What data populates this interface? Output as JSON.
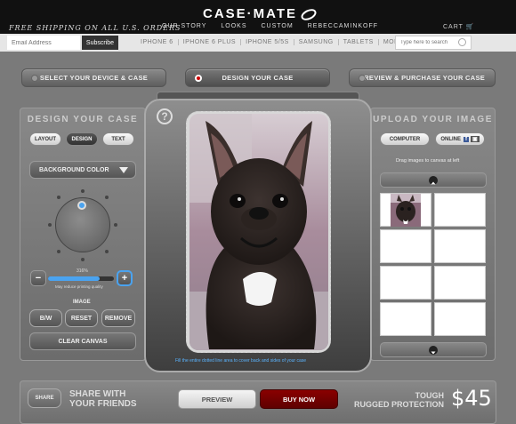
{
  "header": {
    "logo_text": "CASE·MATE",
    "shipping": "FREE SHIPPING ON ALL U.S. ORDERS",
    "nav": [
      "OUR STORY",
      "LOOKS",
      "CUSTOM",
      "REBECCAMINKOFF"
    ],
    "cart_label": "CART"
  },
  "subbar": {
    "email_placeholder": "Email Address",
    "subscribe_label": "Subscribe",
    "devices": [
      "IPHONE 6",
      "IPHONE 6 PLUS",
      "IPHONE 5/5S",
      "SAMSUNG",
      "TABLETS",
      "MORE"
    ],
    "search_placeholder": "Type here to search"
  },
  "steps": [
    "SELECT YOUR DEVICE & CASE",
    "DESIGN YOUR CASE",
    "PREVIEW & PURCHASE YOUR CASE"
  ],
  "design_panel": {
    "title": "DESIGN YOUR CASE",
    "tabs": [
      "LAYOUT",
      "DESIGN",
      "TEXT"
    ],
    "active_tab": "DESIGN",
    "background_label": "BACKGROUND COLOR",
    "zoom_label": "316%",
    "zoom_fraction": 0.78,
    "zoom_note": "May reduce printing quality",
    "image_heading": "IMAGE",
    "image_buttons": [
      "B/W",
      "RESET",
      "REMOVE"
    ],
    "clear_label": "CLEAR CANVAS"
  },
  "canvas": {
    "help": "?",
    "hint": "Fill the entire dotted line area to cover back and sides of your case"
  },
  "upload_panel": {
    "title": "UPLOAD YOUR IMAGE",
    "computer_label": "COMPUTER",
    "online_label": "ONLINE",
    "drag_hint": "Drag images to canvas at left"
  },
  "bottom": {
    "share_label": "SHARE",
    "share_line1": "SHARE WITH",
    "share_line2": "YOUR FRIENDS",
    "preview_label": "PREVIEW",
    "buy_label": "BUY NOW",
    "tough_line1": "TOUGH",
    "tough_line2": "RUGGED PROTECTION",
    "price": "$45"
  },
  "colors": {
    "accent_blue": "#4aa3f0",
    "buy_red": "#7a0000"
  }
}
